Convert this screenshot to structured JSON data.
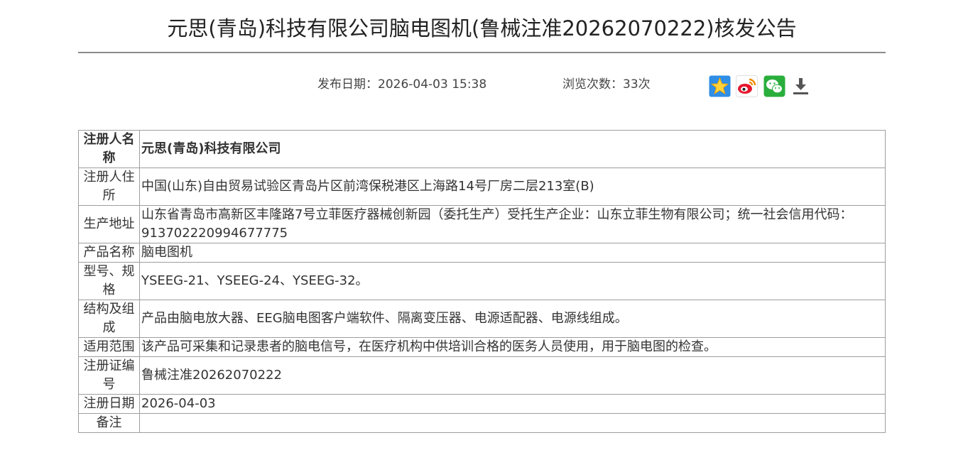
{
  "header": {
    "title": "元思(青岛)科技有限公司脑电图机(鲁械注准20262070222)核发公告"
  },
  "meta": {
    "publish_date": "发布日期：2026-04-03 15:38",
    "view_count": "浏览次数：33次"
  },
  "share": {
    "buttons": [
      {
        "icon": "qzone-star-icon",
        "color": "#2f8ee6"
      },
      {
        "icon": "weibo-icon",
        "color": "#e6162d"
      },
      {
        "icon": "wechat-icon",
        "color": "#2aae3c"
      },
      {
        "icon": "download-icon",
        "color": "#555555"
      }
    ]
  },
  "details": [
    {
      "label": "注册人名称",
      "value": "元思(青岛)科技有限公司"
    },
    {
      "label": "注册人住所",
      "value": "中国(山东)自由贸易试验区青岛片区前湾保税港区上海路14号厂房二层213室(B)"
    },
    {
      "label": "生产地址",
      "value": "山东省青岛市高新区丰隆路7号立菲医疗器械创新园（委托生产）受托生产企业：山东立菲生物有限公司；统一社会信用代码：913702220994677775"
    },
    {
      "label": "产品名称",
      "value": "脑电图机"
    },
    {
      "label": "型号、规格",
      "value": "YSEEG-21、YSEEG-24、YSEEG-32。"
    },
    {
      "label": "结构及组成",
      "value": "产品由脑电放大器、EEG脑电图客户端软件、隔离变压器、电源适配器、电源线组成。"
    },
    {
      "label": "适用范围",
      "value": "该产品可采集和记录患者的脑电信号，在医疗机构中供培训合格的医务人员使用，用于脑电图的检查。"
    },
    {
      "label": "注册证编号",
      "value": "鲁械注准20262070222"
    },
    {
      "label": "注册日期",
      "value": "2026-04-03"
    },
    {
      "label": "备注",
      "value": ""
    }
  ]
}
